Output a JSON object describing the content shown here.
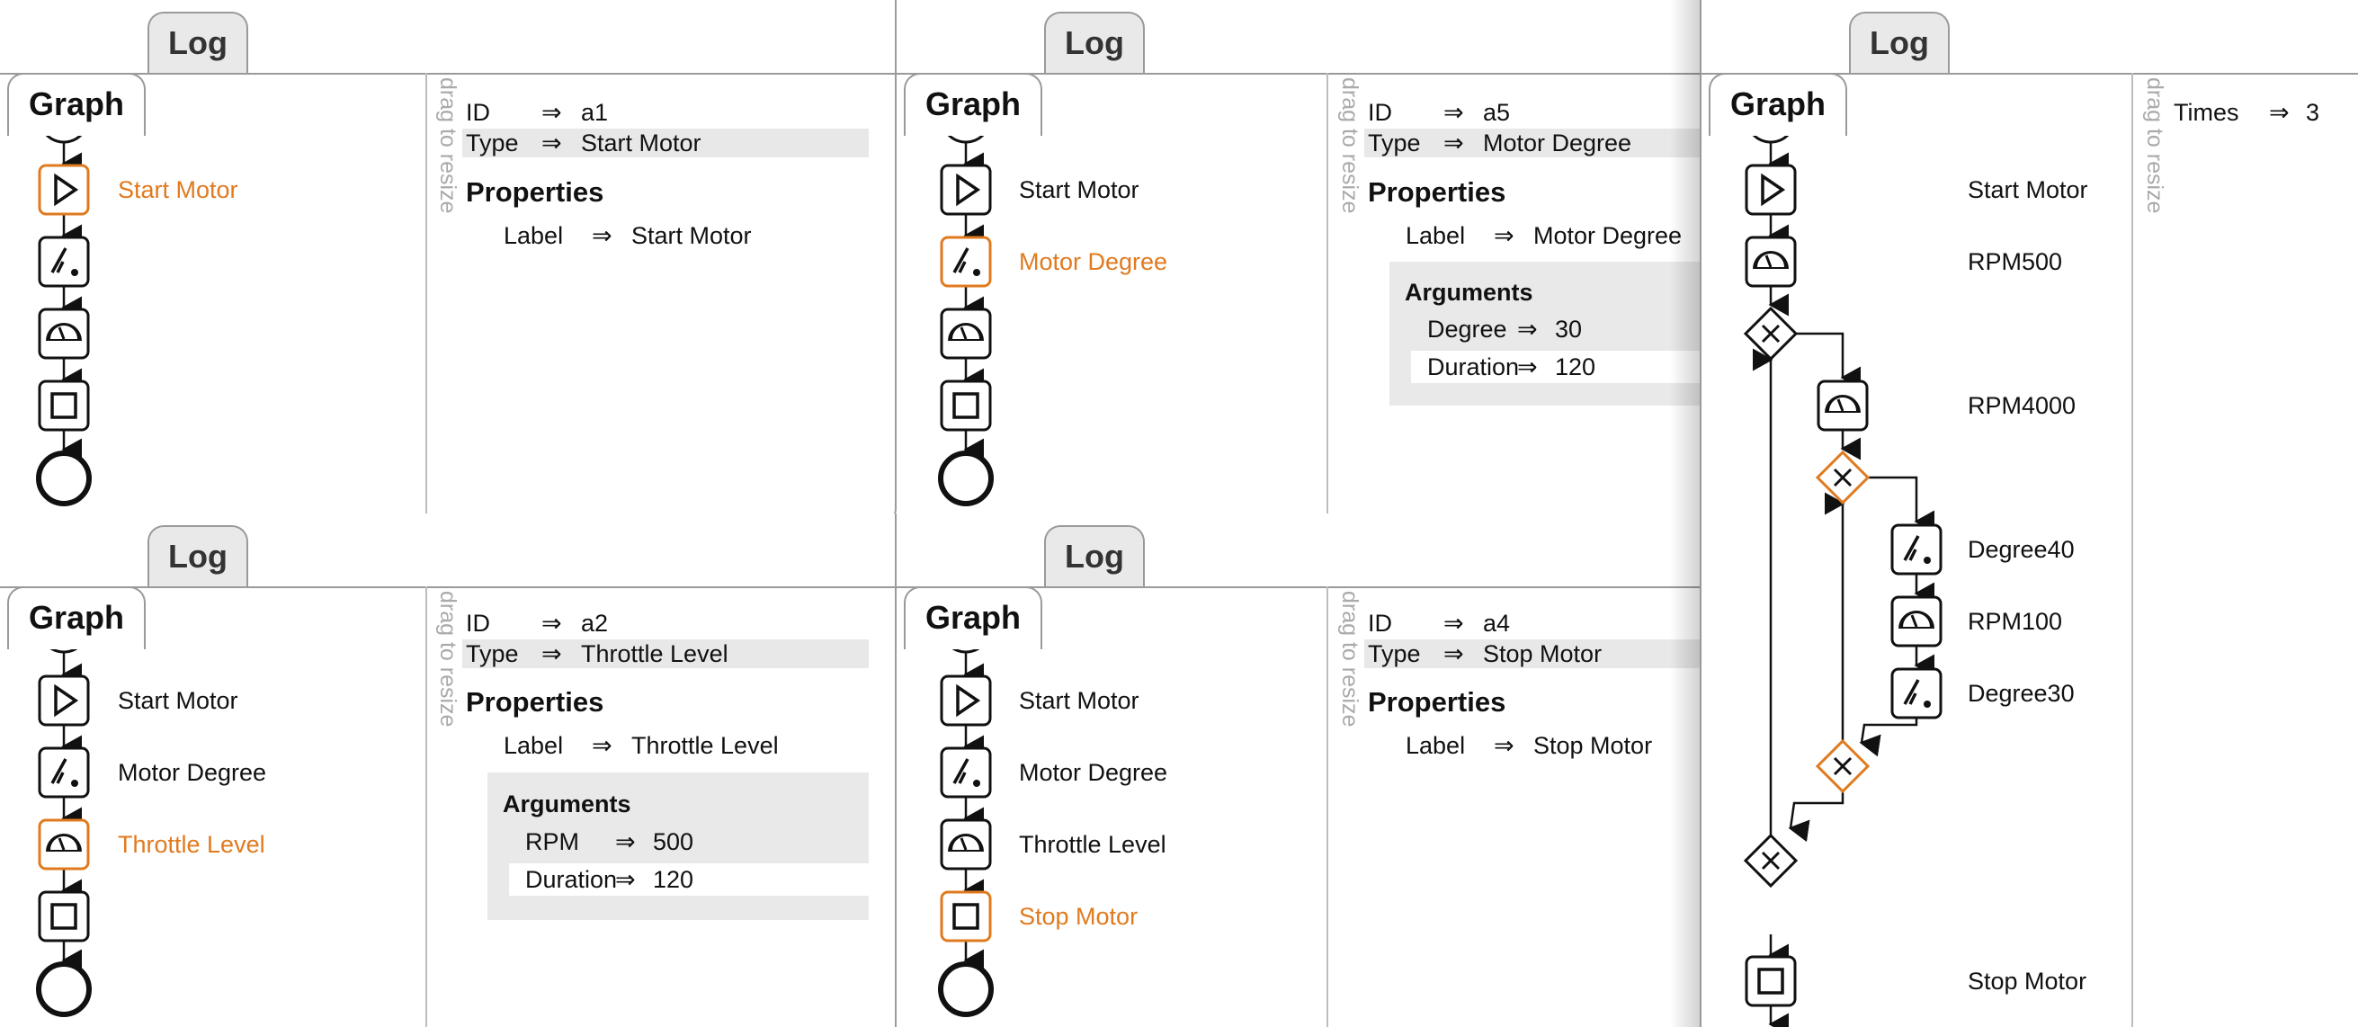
{
  "tabs": {
    "graph": "Graph",
    "log": "Log"
  },
  "drag_hint": "drag to resize",
  "arrow": "⇒",
  "labels": {
    "id": "ID",
    "type": "Type",
    "properties": "Properties",
    "label": "Label",
    "arguments": "Arguments",
    "times": "Times"
  },
  "colors": {
    "selected": "#e07a1f",
    "stroke": "#111111",
    "divider": "#bdbdbd"
  },
  "panels": [
    {
      "graph_nodes": [
        "Start Motor",
        "Motor Degree",
        "Throttle Level",
        "Stop Motor"
      ],
      "selected_node": "Start Motor",
      "info": {
        "id": "a1",
        "type": "Start Motor",
        "label": "Start Motor"
      }
    },
    {
      "graph_nodes": [
        "Start Motor",
        "Motor Degree",
        "Throttle Level",
        "Stop Motor"
      ],
      "selected_node": "Throttle Level",
      "info": {
        "id": "a2",
        "type": "Throttle Level",
        "label": "Throttle Level",
        "arguments": [
          {
            "name": "RPM",
            "value": "500"
          },
          {
            "name": "Duration",
            "value": "120"
          }
        ]
      }
    },
    {
      "graph_nodes": [
        "Start Motor",
        "Motor Degree",
        "Throttle Level",
        "Stop Motor"
      ],
      "selected_node": "Motor Degree",
      "info": {
        "id": "a5",
        "type": "Motor Degree",
        "label": "Motor Degree",
        "arguments": [
          {
            "name": "Degree",
            "value": "30"
          },
          {
            "name": "Duration",
            "value": "120"
          }
        ]
      }
    },
    {
      "graph_nodes": [
        "Start Motor",
        "Motor Degree",
        "Throttle Level",
        "Stop Motor"
      ],
      "selected_node": "Stop Motor",
      "info": {
        "id": "a4",
        "type": "Stop Motor",
        "label": "Stop Motor"
      }
    },
    {
      "graph_nodes": [
        "Start Motor",
        "RPM500",
        "RPM4000",
        "Degree40",
        "RPM100",
        "Degree30",
        "Stop Motor"
      ],
      "selected_node": "loop gateways",
      "info": {
        "times": "3"
      }
    }
  ],
  "icons": [
    "start-event-icon",
    "play-icon",
    "degree-icon",
    "gauge-icon",
    "stop-icon",
    "gateway-icon",
    "end-event-icon"
  ]
}
